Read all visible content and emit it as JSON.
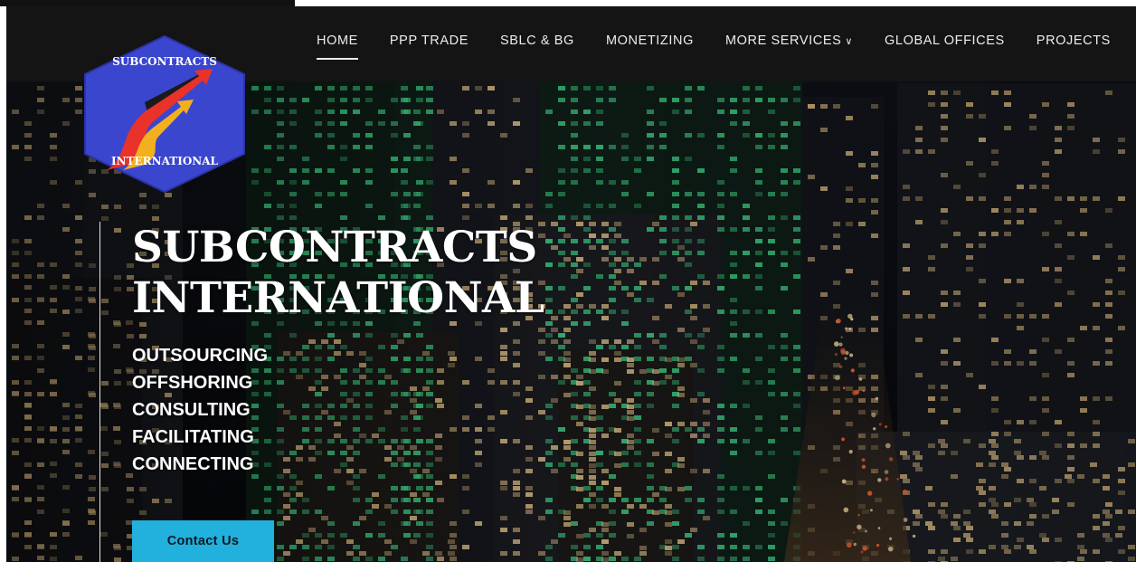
{
  "logo": {
    "line_top": "SUBCONTRACTS",
    "line_bottom": "INTERNATIONAL",
    "colors": {
      "hexagon": "#3b46cf",
      "arrow_red": "#e8322a",
      "arrow_gold": "#f2b01e",
      "stripe_black": "#1a1a1a"
    }
  },
  "nav": {
    "items": [
      {
        "label": "HOME",
        "active": true
      },
      {
        "label": "PPP TRADE"
      },
      {
        "label": "SBLC & BG"
      },
      {
        "label": "MONETIZING"
      },
      {
        "label": "MORE SERVICES",
        "icon": "chevron-down-icon",
        "chevron": "∨"
      },
      {
        "label": "GLOBAL OFFICES"
      },
      {
        "label": "PROJECTS"
      }
    ]
  },
  "hero": {
    "title_line1": "SUBCONTRACTS",
    "title_line2": "INTERNATIONAL",
    "services": [
      "OUTSOURCING",
      "OFFSHORING",
      "CONSULTING",
      "FACILITATING",
      "CONNECTING"
    ],
    "cta_label": "Contact Us"
  },
  "colors": {
    "navbar": "#141414",
    "accent": "#22b0dc",
    "text": "#ffffff",
    "window_green": "#3fd98a"
  }
}
